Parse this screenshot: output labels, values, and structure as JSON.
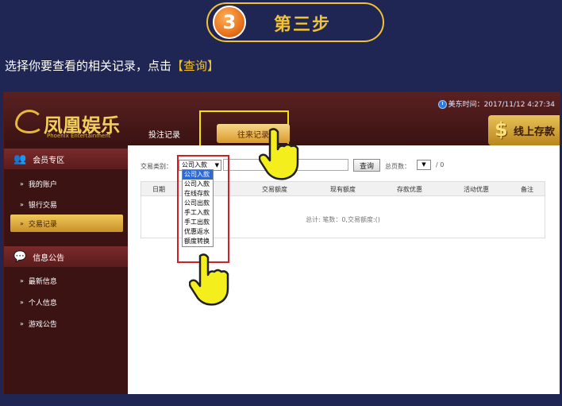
{
  "step": {
    "number": "3",
    "title": "第三步"
  },
  "instruction": {
    "prefix": "选择你要查看的相关记录，点击",
    "highlight": "【查询】"
  },
  "header": {
    "clock": "美东时间：2017/11/12 4:27:34",
    "logo_text": "凤凰娱乐",
    "logo_sub": "Phoenix Entertainment",
    "tabs": [
      {
        "label": "投注记录"
      },
      {
        "label": "往来记录"
      }
    ],
    "deposit_label": "线上存款",
    "deposit_icon": "$"
  },
  "sidebar": {
    "member_section": "会员专区",
    "member_items": [
      {
        "label": "我的账户"
      },
      {
        "label": "银行交易"
      },
      {
        "label": "交易记录"
      }
    ],
    "info_section": "信息公告",
    "info_items": [
      {
        "label": "最新信息"
      },
      {
        "label": "个人信息"
      },
      {
        "label": "游戏公告"
      }
    ]
  },
  "filter": {
    "type_label": "交易类别：",
    "selected": "公司入款",
    "query_label": "查询",
    "pages_label": "总页数：",
    "page_value": "",
    "page_separator": "/ 0",
    "options": [
      "公司入款",
      "公司入款",
      "在线存款",
      "公司出款",
      "手工入款",
      "手工出款",
      "优惠返水",
      "额度转换"
    ]
  },
  "table": {
    "columns": [
      "日期",
      "交易额度",
      "现有额度",
      "存款优惠",
      "活动优惠",
      "备注"
    ],
    "summary": "总计: 笔数：0,交易额度:()"
  },
  "colors": {
    "background": "#1f2654",
    "accent": "#f2c230",
    "highlight_box": "#f4e400",
    "dropdown_box": "#d0202a"
  }
}
